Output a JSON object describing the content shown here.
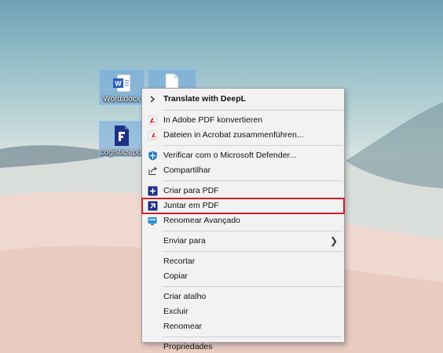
{
  "desktop": {
    "icons": [
      {
        "label": "Word.docx",
        "type": "word-file"
      },
      {
        "label": "",
        "type": "blank-file"
      },
      {
        "label": "Logistics.pdf",
        "type": "pdf-file"
      }
    ]
  },
  "context_menu": {
    "items": [
      {
        "label": "Translate with DeepL",
        "icon": "deepl-icon",
        "bold": true
      },
      {
        "label": "In Adobe PDF konvertieren",
        "icon": "adobe-pdf-icon"
      },
      {
        "label": "Dateien in Acrobat zusammenführen...",
        "icon": "acrobat-combine-icon"
      },
      {
        "label": "Verificar com o Microsoft Defender...",
        "icon": "defender-shield-icon"
      },
      {
        "label": "Compartilhar",
        "icon": "share-icon"
      },
      {
        "label": "Criar para PDF",
        "icon": "create-pdf-icon"
      },
      {
        "label": "Juntar em PDF",
        "icon": "merge-pdf-icon",
        "highlighted": true
      },
      {
        "label": "Renomear Avançado",
        "icon": "advanced-rename-icon"
      },
      {
        "label": "Enviar para",
        "has_submenu": true
      },
      {
        "label": "Recortar"
      },
      {
        "label": "Copiar"
      },
      {
        "label": "Criar atalho"
      },
      {
        "label": "Excluir"
      },
      {
        "label": "Renomear"
      },
      {
        "label": "Propriedades"
      }
    ]
  },
  "colors": {
    "highlight_border": "#d3202a",
    "menu_bg": "#f2f2f2",
    "selection": "#6ea5dc"
  }
}
